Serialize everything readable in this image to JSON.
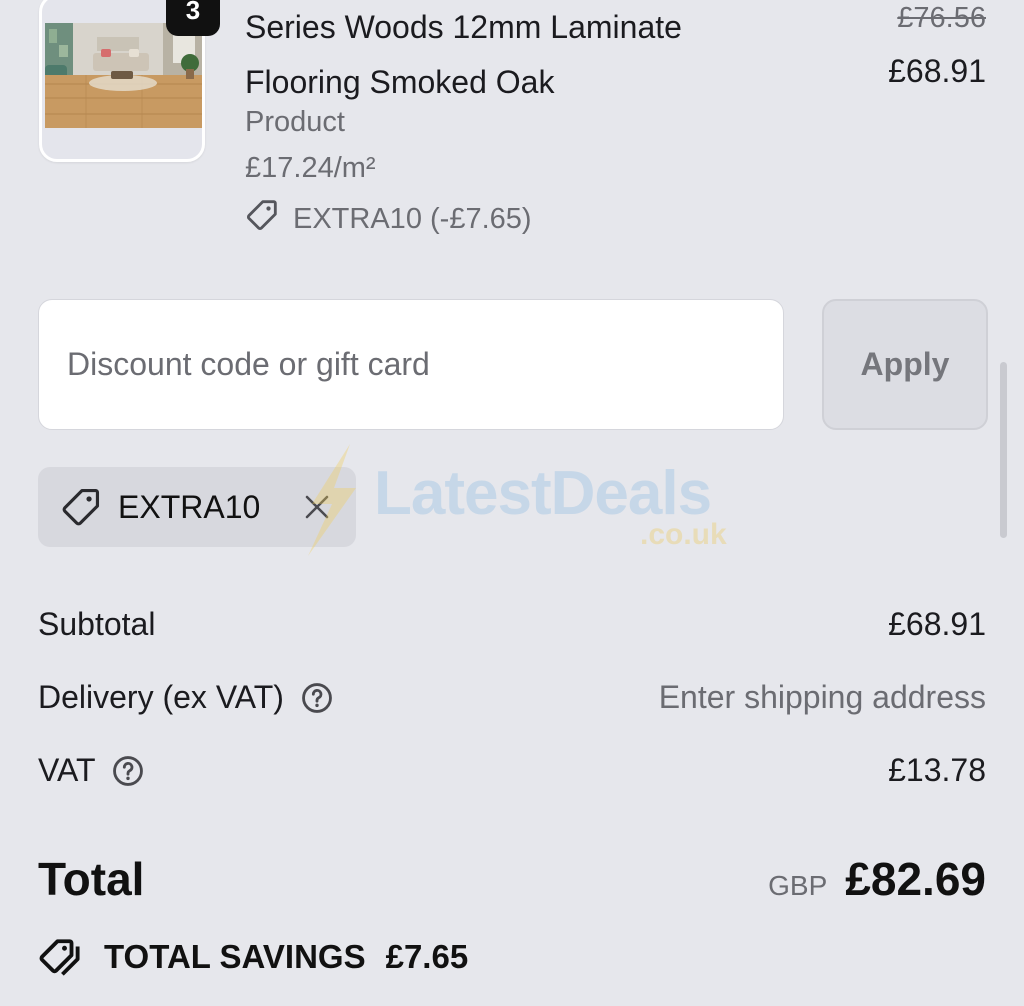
{
  "product": {
    "quantity": "3",
    "title": "Series Woods 12mm Laminate Flooring Smoked Oak",
    "subtitle": "Product",
    "unit_price": "£17.24/m²",
    "discount_applied": "EXTRA10 (-£7.65)",
    "price_original": "£76.56",
    "price_current": "£68.91",
    "thumbnail": "laminate-flooring-room-photo"
  },
  "discount": {
    "placeholder": "Discount code or gift card",
    "value": "",
    "apply_label": "Apply"
  },
  "applied_code": {
    "label": "EXTRA10",
    "tag_icon": "tag-icon",
    "remove_icon": "close-icon"
  },
  "watermark": {
    "brand": "LatestDeals",
    "tld": ".co.uk"
  },
  "summary": {
    "subtotal_label": "Subtotal",
    "subtotal_value": "£68.91",
    "delivery_label": "Delivery (ex VAT)",
    "delivery_value": "Enter shipping address",
    "vat_label": "VAT",
    "vat_value": "£13.78",
    "total_label": "Total",
    "currency": "GBP",
    "total_value": "£82.69",
    "savings_label": "TOTAL SAVINGS",
    "savings_value": "£7.65"
  },
  "colors": {
    "background": "#e6e7ec",
    "text_primary": "#1b1b1f",
    "text_muted": "#6b6c72",
    "chip_bg": "#d7d8de",
    "apply_bg": "#dcdde3"
  }
}
